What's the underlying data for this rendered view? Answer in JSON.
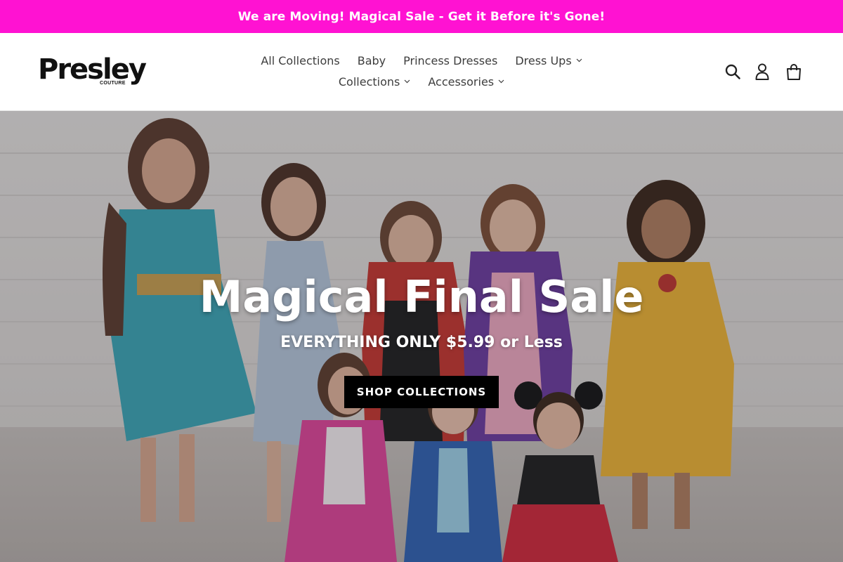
{
  "announcement": {
    "text": "We are Moving! Magical Sale - Get it Before it's Gone!"
  },
  "brand": {
    "name": "Presley",
    "tagline": "COUTURE"
  },
  "nav": {
    "row1": [
      {
        "label": "All Collections",
        "has_dropdown": false
      },
      {
        "label": "Baby",
        "has_dropdown": false
      },
      {
        "label": "Princess Dresses",
        "has_dropdown": false
      },
      {
        "label": "Dress Ups",
        "has_dropdown": true
      }
    ],
    "row2": [
      {
        "label": "Collections",
        "has_dropdown": true
      },
      {
        "label": "Accessories",
        "has_dropdown": true
      }
    ]
  },
  "header_icons": [
    "search-icon",
    "account-icon",
    "cart-icon"
  ],
  "hero": {
    "title": "Magical Final Sale",
    "subtitle": "EVERYTHING ONLY $5.99 or Less",
    "cta": "SHOP COLLECTIONS"
  },
  "colors": {
    "announcement_bg": "#ff12d2",
    "cta_bg": "#000000",
    "text": "#3d3d3d"
  }
}
